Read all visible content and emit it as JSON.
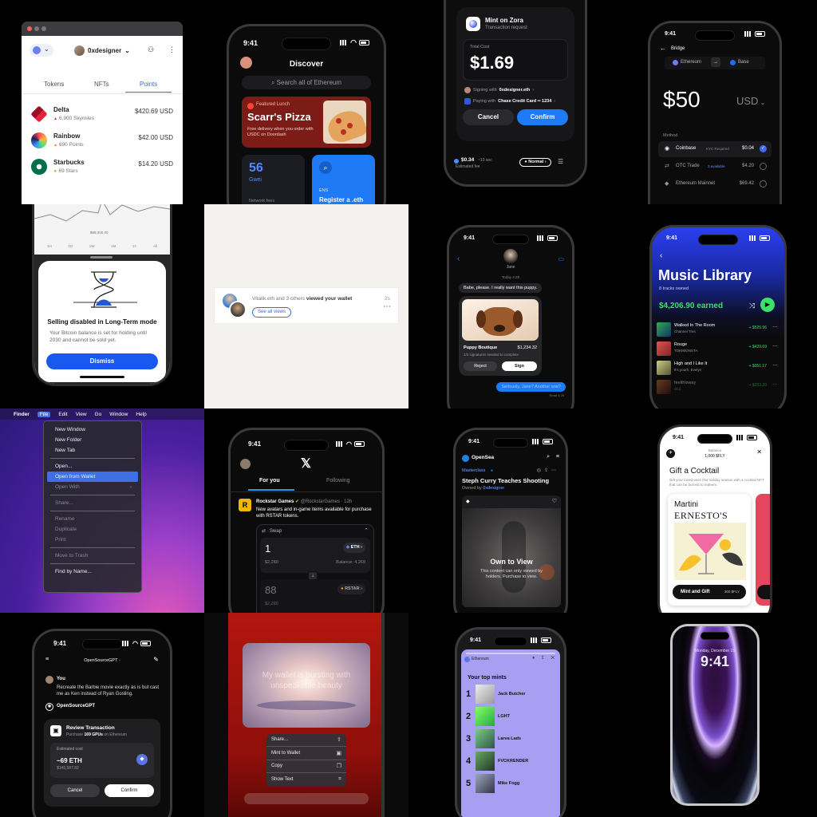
{
  "c1": {
    "account": "0xdesigner",
    "tabs": [
      "Tokens",
      "NFTs",
      "Points"
    ],
    "items": [
      {
        "name": "Delta",
        "sub": "6,900 Skymiles",
        "value": "$420.69 USD"
      },
      {
        "name": "Rainbow",
        "sub": "690 Points",
        "value": "$42.00 USD"
      },
      {
        "name": "Starbucks",
        "sub": "69 Stars",
        "value": "$14.20 USD"
      }
    ]
  },
  "c2": {
    "time": "9:41",
    "title": "Discover",
    "search": "Search all of Ethereum",
    "badge": "Featured Lunch",
    "banner_title": "Scarr's Pizza",
    "banner_sub": "Free delivery when you order with USDC on Doordash",
    "gas_value": "56",
    "gas_unit": "Gwei",
    "gas_label": "Network fees",
    "ens_label": "ENS",
    "ens_title": "Register a .eth"
  },
  "c3": {
    "title": "Mint on Zora",
    "sub": "Transaction request",
    "cost_label": "Total Cost",
    "cost": "$1.69",
    "signing_prefix": "Signing with",
    "signing": "0xdesigner.eth",
    "paying_prefix": "Paying with",
    "paying": "Chase Credit Card •• 1234",
    "cancel": "Cancel",
    "confirm": "Confirm",
    "fee": "$0.34",
    "fee_time": "~10 sec",
    "fee_label": "Estimated fee",
    "speed": "Normal"
  },
  "c4": {
    "time": "9:41",
    "title": "Bridge",
    "from": "Ethereum",
    "to": "Base",
    "amount": "$50",
    "currency": "USD",
    "method_label": "Method",
    "methods": [
      {
        "name": "Coinbase",
        "tag": "KYC Required",
        "price": "$0.04"
      },
      {
        "name": "OTC Trade",
        "tag": "3 available",
        "price": "$4.20"
      },
      {
        "name": "Ethereum Mainnet",
        "tag": "",
        "price": "$69.42"
      }
    ]
  },
  "c5": {
    "price_label": "$88,000.00",
    "ticks": [
      "1H",
      "1D",
      "1W",
      "1M",
      "1Y",
      "All"
    ],
    "title": "Selling disabled in Long-Term mode",
    "body": "Your Bitcoin balance is set for holding until 2030 and cannot be sold yet.",
    "dismiss": "Dismiss"
  },
  "c6": {
    "text_prefix": "Vitalik.eth and 3 others",
    "text_bold": "viewed your wallet",
    "time": "2s",
    "button": "See all views"
  },
  "c7": {
    "time": "9:41",
    "contact": "Jane",
    "date": "Today 4:28",
    "msg1": "Babe, please. I really want this puppy.",
    "card_title": "Puppy Boutique",
    "card_price": "$1,234.32",
    "card_sub": "1/2 signatures needed to complete",
    "reject": "Reject",
    "sign": "Sign",
    "reply": "Seriously, Jane? Another one?",
    "read": "Read 4:29"
  },
  "c8": {
    "time": "9:41",
    "title": "Music Library",
    "count": "8 tracks owned",
    "earned": "$4,206.90 earned",
    "tracks": [
      {
        "title": "Walked In The Room",
        "artist": "Channel Tres",
        "amt": "+ $525.96"
      },
      {
        "title": "Rouge",
        "artist": "TOKIMONSTA",
        "amt": "+ $420.69"
      },
      {
        "title": "High and I Like It",
        "artist": "It's yourh, Evelyn",
        "amt": "+ $351.17"
      },
      {
        "title": "feelthisway",
        "artist": "dlcd",
        "amt": "+ $253.20"
      }
    ]
  },
  "c9": {
    "menubar": [
      "Finder",
      "File",
      "Edit",
      "View",
      "Go",
      "Window",
      "Help"
    ],
    "items": [
      {
        "label": "New Window",
        "kind": "normal"
      },
      {
        "label": "New Folder",
        "kind": "normal"
      },
      {
        "label": "New Tab",
        "kind": "normal"
      },
      {
        "label": "",
        "kind": "sep"
      },
      {
        "label": "Open...",
        "kind": "normal"
      },
      {
        "label": "Open from Wallet",
        "kind": "selected"
      },
      {
        "label": "Open With",
        "kind": "disabled",
        "arrow": "›"
      },
      {
        "label": "",
        "kind": "sep"
      },
      {
        "label": "Share...",
        "kind": "disabled"
      },
      {
        "label": "",
        "kind": "sep"
      },
      {
        "label": "Rename",
        "kind": "disabled"
      },
      {
        "label": "Duplicate",
        "kind": "disabled"
      },
      {
        "label": "Print",
        "kind": "disabled"
      },
      {
        "label": "",
        "kind": "sep"
      },
      {
        "label": "Move to Trash",
        "kind": "disabled"
      },
      {
        "label": "",
        "kind": "sep"
      },
      {
        "label": "Find by Name...",
        "kind": "normal"
      }
    ]
  },
  "c10": {
    "time": "9:41",
    "tab1": "For you",
    "tab2": "Following",
    "author": "Rockstar Games",
    "handle": "@RockstarGames · 12h",
    "text": "New avatars and in-game items available for purchase with RSTAR tokens.",
    "swap": "Swap",
    "amt1": "1",
    "usd1": "$2,280",
    "tok1": "ETH",
    "bal1": "Balance: 4.269",
    "amt2": "88",
    "usd2": "$2,280",
    "tok2": "RSTAR"
  },
  "c11": {
    "time": "9:41",
    "brand": "OpenSea",
    "collection": "Masterclass",
    "title": "Steph Curry Teaches Shooting",
    "owner_prefix": "Owned by",
    "owner": "0xdesigner",
    "chain": "Ethereum",
    "overlay_title": "Own to View",
    "overlay_body": "This content can only viewed by holders. Purchase to view."
  },
  "c12": {
    "time": "9:41",
    "balance_label": "Balance",
    "balance": "1,000 $FLY",
    "title": "Gift a Cocktail",
    "sub": "Gift your loved ones this holiday season with a cocktail NFT that can be burned to redeem.",
    "card_top": "Martini",
    "card_brand": "ERNESTO'S",
    "cta": "Mint and Gift",
    "cta_price": "300 $FLY"
  },
  "c13": {
    "time": "9:41",
    "title": "OpenSourceGPT",
    "you": "You",
    "prompt": "Recreate the Barbie movie exactly as is but cast me as Ken instead of Ryan Gosling.",
    "bot": "OpenSourceGPT",
    "review": "Review Transaction",
    "review_sub_pre": "Purchase",
    "review_sub_bold": "169 GPUs",
    "review_sub_post": "on Ethereum",
    "est_label": "Estimated cost",
    "eth": "~69 ETH",
    "usd": "$146,587.82",
    "cancel": "Cancel",
    "confirm": "Confirm"
  },
  "c14": {
    "quote": "My wallet is bursting with unspeakable beauty",
    "menu": [
      "Share...",
      "Mint to Wallet",
      "Copy",
      "Show Text"
    ]
  },
  "c15": {
    "time": "9:41",
    "chain": "Ethereum",
    "heading": "Your top mints",
    "mints": [
      {
        "rank": "1",
        "name": "Jack Butcher"
      },
      {
        "rank": "2",
        "name": "LGHT"
      },
      {
        "rank": "3",
        "name": "Larva Lads"
      },
      {
        "rank": "4",
        "name": "FVCKRENDER"
      },
      {
        "rank": "5",
        "name": "Mike Fogg"
      }
    ]
  },
  "c16": {
    "date": "Monday, December 15",
    "time": "9:41"
  }
}
